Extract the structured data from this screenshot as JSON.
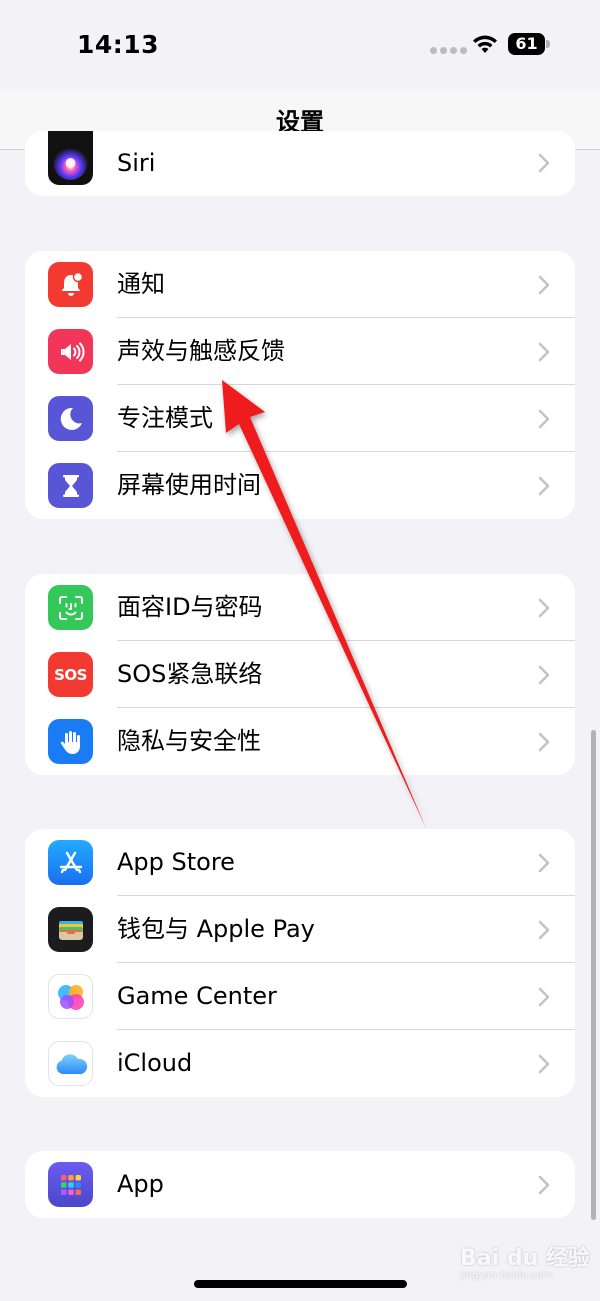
{
  "status_bar": {
    "time": "14:13",
    "battery": "61"
  },
  "header": {
    "title": "设置"
  },
  "groups": [
    {
      "items": [
        {
          "label": "Siri",
          "icon": "siri-icon"
        }
      ]
    },
    {
      "items": [
        {
          "label": "通知",
          "icon": "bell-icon",
          "color": "#f23a30"
        },
        {
          "label": "声效与触感反馈",
          "icon": "speaker-icon",
          "color": "#f2365a"
        },
        {
          "label": "专注模式",
          "icon": "moon-icon",
          "color": "#5856d6"
        },
        {
          "label": "屏幕使用时间",
          "icon": "hourglass-icon",
          "color": "#5856d6"
        }
      ]
    },
    {
      "items": [
        {
          "label": "面容ID与密码",
          "icon": "face-id-icon",
          "color": "#34c759"
        },
        {
          "label": "SOS紧急联络",
          "icon": "sos-icon",
          "icon_text": "SOS",
          "color": "#f23a30"
        },
        {
          "label": "隐私与安全性",
          "icon": "hand-icon",
          "color": "#1a7cf5"
        }
      ]
    },
    {
      "items": [
        {
          "label": "App Store",
          "icon": "app-store-icon",
          "color": "#1a8cf5"
        },
        {
          "label": "钱包与 Apple Pay",
          "icon": "wallet-icon",
          "color": "#1c1c1e"
        },
        {
          "label": "Game Center",
          "icon": "game-center-icon",
          "color": "#ffffff"
        },
        {
          "label": "iCloud",
          "icon": "icloud-icon",
          "color": "#ffffff"
        }
      ]
    },
    {
      "items": [
        {
          "label": "App",
          "icon": "apps-grid-icon",
          "color": "#5856d6"
        }
      ]
    }
  ],
  "annotation": {
    "arrow_color": "#ee1c1c"
  },
  "watermark": {
    "text": "Bai du 经验",
    "sub": "jingyan.baidu.com"
  }
}
